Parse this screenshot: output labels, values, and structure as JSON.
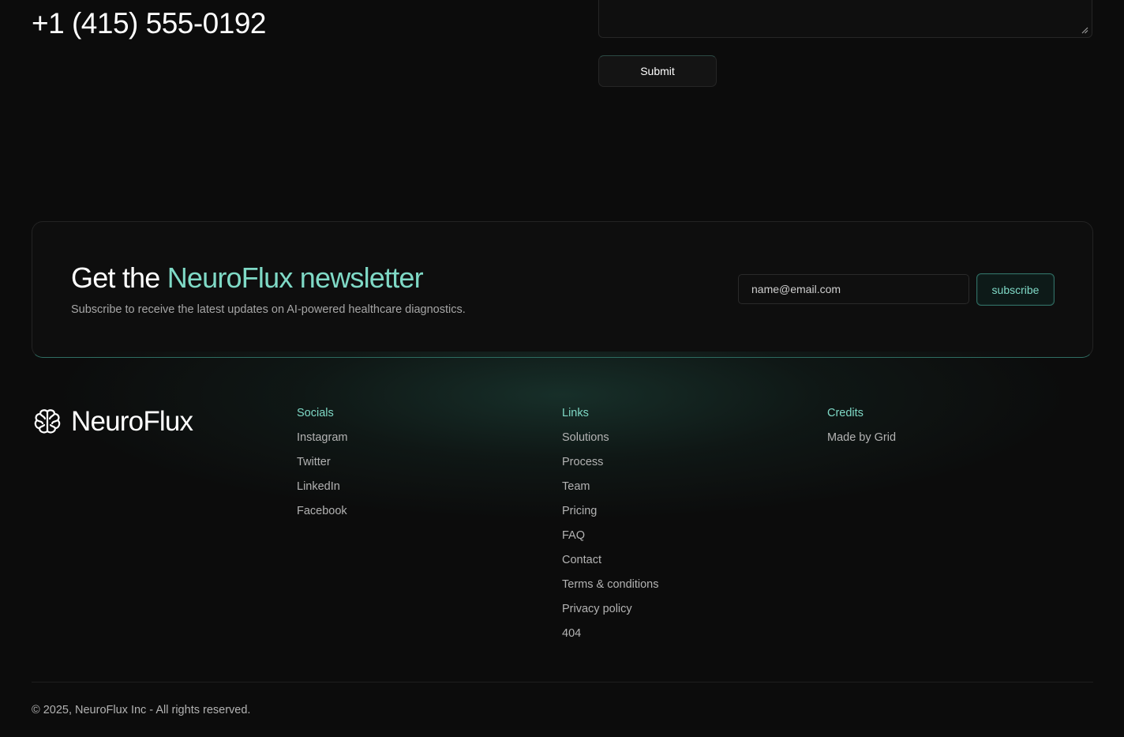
{
  "contact": {
    "phone": "+1 (415) 555-0192",
    "submit_label": "Submit"
  },
  "newsletter": {
    "title_prefix": "Get the ",
    "title_accent": "NeuroFlux newsletter",
    "subtitle": "Subscribe to receive the latest updates on AI-powered healthcare diagnostics.",
    "email_placeholder": "name@email.com",
    "subscribe_label": "subscribe"
  },
  "footer": {
    "brand_name": "NeuroFlux",
    "brand_icon": "brain-icon",
    "columns": [
      {
        "title": "Socials",
        "items": [
          "Instagram",
          "Twitter",
          "LinkedIn",
          "Facebook"
        ]
      },
      {
        "title": "Links",
        "items": [
          "Solutions",
          "Process",
          "Team",
          "Pricing",
          "FAQ",
          "Contact",
          "Terms & conditions",
          "Privacy policy",
          "404"
        ]
      },
      {
        "title": "Credits",
        "items": [
          "Made by Grid"
        ]
      }
    ],
    "copyright": "© 2025, NeuroFlux Inc - All rights reserved."
  },
  "colors": {
    "background": "#0c0c0c",
    "accent": "#7fd9c6",
    "muted_text": "#b3b3b3"
  }
}
